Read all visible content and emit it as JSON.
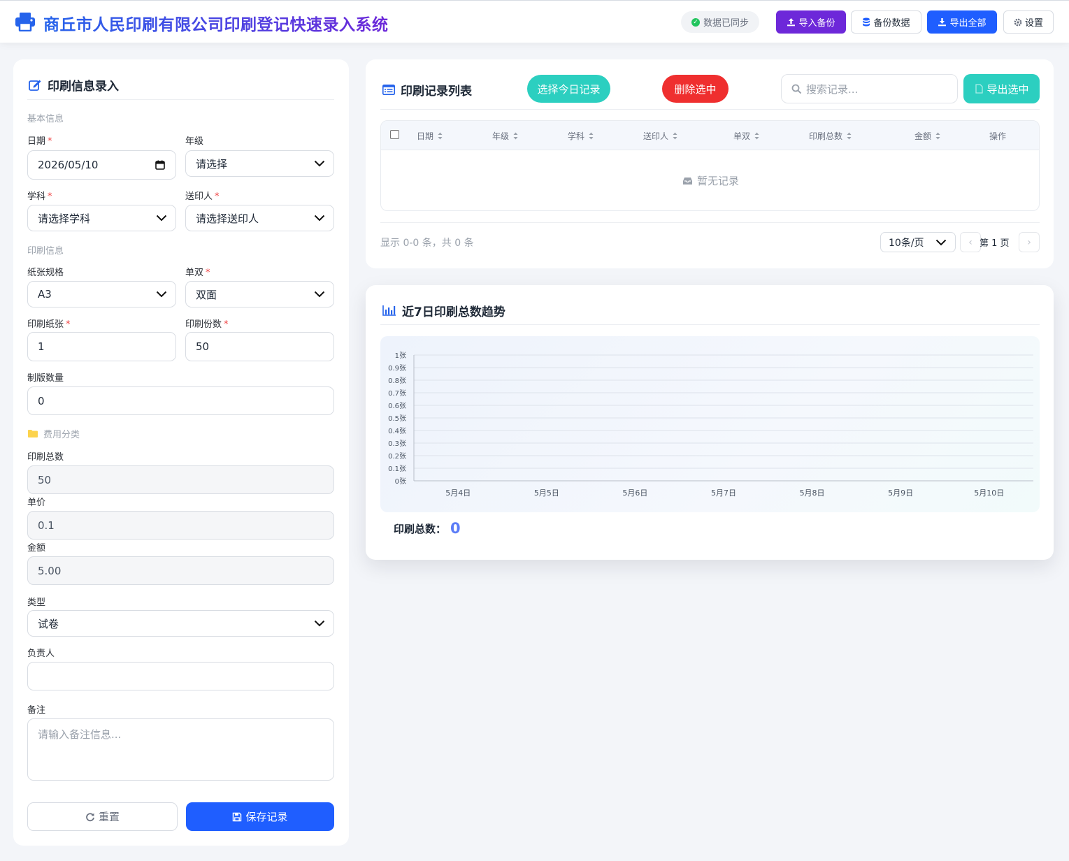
{
  "header": {
    "title": "商丘市人民印刷有限公司印刷登记快速录入系统",
    "sync_status": "数据已同步",
    "buttons": {
      "import_backup": "导入备份",
      "backup_data": "备份数据",
      "export_all": "导出全部",
      "settings": "设置"
    },
    "colors": {
      "import": "#6d28d9",
      "export": "#1f5eff"
    }
  },
  "form": {
    "title": "印刷信息录入",
    "sections": {
      "basic": "基本信息",
      "print": "印刷信息",
      "cost": "费用分类"
    },
    "date": {
      "label": "日期",
      "value": "2026/05/10"
    },
    "grade": {
      "label": "年级",
      "value": "请选择"
    },
    "subject": {
      "label": "学科",
      "value": "请选择学科"
    },
    "sender": {
      "label": "送印人",
      "value": "请选择送印人"
    },
    "paper_size": {
      "label": "纸张规格",
      "value": "A3"
    },
    "sides": {
      "label": "单双",
      "value": "双面"
    },
    "sheets": {
      "label": "印刷纸张",
      "value": "1"
    },
    "copies": {
      "label": "印刷份数",
      "value": "50"
    },
    "plates": {
      "label": "制版数量",
      "value": "0"
    },
    "total": {
      "label": "印刷总数",
      "value": "50"
    },
    "unit_price": {
      "label": "单价",
      "value": "0.1"
    },
    "amount": {
      "label": "金额",
      "value": "5.00"
    },
    "type": {
      "label": "类型",
      "value": "试卷"
    },
    "owner": {
      "label": "负责人",
      "value": ""
    },
    "note": {
      "label": "备注",
      "placeholder": "请输入备注信息..."
    },
    "reset_label": "重置",
    "save_label": "保存记录"
  },
  "list": {
    "title": "印刷记录列表",
    "select_today": "选择今日记录",
    "delete_selected": "删除选中",
    "search_placeholder": "搜索记录...",
    "export_selected": "导出选中",
    "columns": [
      "日期",
      "年级",
      "学科",
      "送印人",
      "单双",
      "印刷总数",
      "金额",
      "操作"
    ],
    "empty_text": "暂无记录",
    "pagination": {
      "info": "显示 0-0 条，共 0 条",
      "page_size": "10条/页",
      "current": "第 1 页",
      "prev": "‹",
      "next": "›"
    }
  },
  "chart": {
    "title": "近7日印刷总数趋势",
    "total_label": "印刷总数：",
    "total_value": "0"
  },
  "chart_data": {
    "type": "line",
    "title": "近7日印刷总数趋势",
    "categories": [
      "5月4日",
      "5月5日",
      "5月6日",
      "5月7日",
      "5月8日",
      "5月9日",
      "5月10日"
    ],
    "series": [
      {
        "values": [
          0,
          0,
          0,
          0,
          0,
          0,
          0
        ]
      }
    ],
    "y_ticks": [
      "0张",
      "0.1张",
      "0.2张",
      "0.3张",
      "0.4张",
      "0.5张",
      "0.6张",
      "0.7张",
      "0.8张",
      "0.9张",
      "1张"
    ],
    "ylim": [
      0,
      1
    ],
    "grid": true,
    "xlabel": "",
    "ylabel": ""
  }
}
